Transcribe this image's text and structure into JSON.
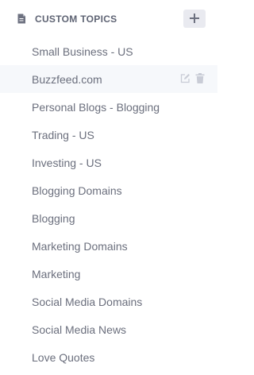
{
  "header": {
    "title": "CUSTOM TOPICS",
    "icon": "document-icon",
    "add_button_icon": "plus-icon"
  },
  "topics": {
    "items": [
      {
        "label": "Small Business - US"
      },
      {
        "label": "Buzzfeed.com",
        "active": true,
        "actions": [
          "edit-icon",
          "trash-icon"
        ]
      },
      {
        "label": "Personal Blogs - Blogging"
      },
      {
        "label": "Trading - US"
      },
      {
        "label": "Investing - US"
      },
      {
        "label": "Blogging Domains"
      },
      {
        "label": "Blogging"
      },
      {
        "label": "Marketing Domains"
      },
      {
        "label": "Marketing"
      },
      {
        "label": "Social Media Domains"
      },
      {
        "label": "Social Media News"
      },
      {
        "label": "Love Quotes"
      }
    ]
  },
  "colors": {
    "header_text": "#5f6474",
    "item_text": "#6b6f7d",
    "active_row_bg": "#f6f8fb",
    "add_button_bg": "#e9eaf0",
    "icon_muted": "#c9ccd6"
  }
}
